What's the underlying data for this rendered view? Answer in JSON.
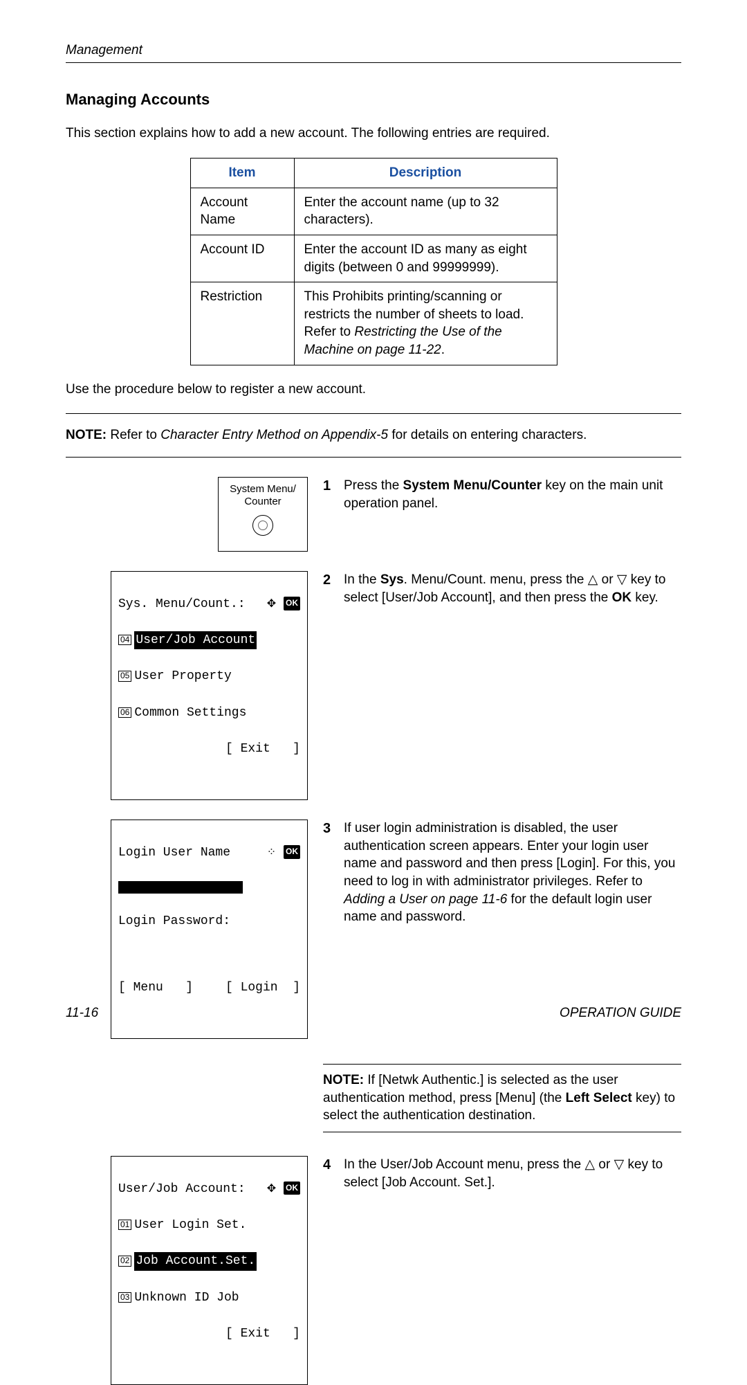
{
  "header": {
    "topic": "Management"
  },
  "title": "Managing Accounts",
  "intro": "This section explains how to add a new account. The following entries are required.",
  "table": {
    "head_item": "Item",
    "head_desc": "Description",
    "rows": [
      {
        "item": "Account Name",
        "desc": "Enter the account name (up to 32 characters)."
      },
      {
        "item": "Account ID",
        "desc": "Enter the account ID as many as eight digits (between 0 and 99999999)."
      },
      {
        "item": "Restriction",
        "desc_pre": "This Prohibits printing/scanning or restricts the number of sheets to load. Refer to ",
        "desc_em": "Restricting the Use of the Machine on page 11-22",
        "desc_post": "."
      }
    ]
  },
  "proc_intro": "Use the procedure below to register a new account.",
  "note_main": {
    "label": "NOTE:",
    "pre": " Refer to ",
    "em": "Character Entry Method on Appendix-5",
    "post": " for details on entering characters."
  },
  "key": {
    "line1": "System Menu/",
    "line2": "Counter"
  },
  "steps": {
    "s1": {
      "num": "1",
      "pre": "Press the ",
      "b1": "System Menu/Counter",
      "post": " key on the main unit operation panel."
    },
    "s2": {
      "num": "2",
      "pre": "In the ",
      "b1": "Sys",
      "mid1": ". Menu/Count. menu, press the ",
      "tri_up": "△",
      "mid2": " or ",
      "tri_dn": "▽",
      "mid3": " key to select [User/Job Account], and then press the ",
      "b2": "OK",
      "post": " key."
    },
    "s3": {
      "num": "3",
      "pre": "If user login administration is disabled, the user authentication screen appears. Enter your login user name and password and then press [Login]. For this, you need to log in with administrator privileges. Refer to ",
      "em": "Adding a User on page 11-6",
      "post": " for the default login user name and password."
    },
    "note2": {
      "label": "NOTE:",
      "text": " If [Netwk Authentic.] is selected as the user authentication method, press [Menu] (the ",
      "b": "Left Select",
      "post": " key) to select the authentication destination."
    },
    "s4": {
      "num": "4",
      "pre": "In the User/Job Account menu, press the ",
      "tri_up": "△",
      "mid": " or ",
      "tri_dn": "▽",
      "post": " key to select [Job Account. Set.]."
    }
  },
  "lcd1": {
    "title": "Sys. Menu/Count.:",
    "ok": "OK",
    "r04_num": "04",
    "r04_txt": "User/Job Account",
    "r05_num": "05",
    "r05_txt": "User Property",
    "r06_num": "06",
    "r06_txt": "Common Settings",
    "exit": "Exit"
  },
  "lcd2": {
    "title": "Login User Name",
    "ok": "OK",
    "pw_label": "Login Password:",
    "menu": "Menu",
    "login": "Login"
  },
  "lcd3": {
    "title": "User/Job Account:",
    "ok": "OK",
    "r01_num": "01",
    "r01_txt": "User Login Set.",
    "r02_num": "02",
    "r02_txt": "Job Account.Set.",
    "r03_num": "03",
    "r03_txt": "Unknown ID Job",
    "exit": "Exit"
  },
  "footer": {
    "page": "11-16",
    "guide": "OPERATION GUIDE"
  }
}
